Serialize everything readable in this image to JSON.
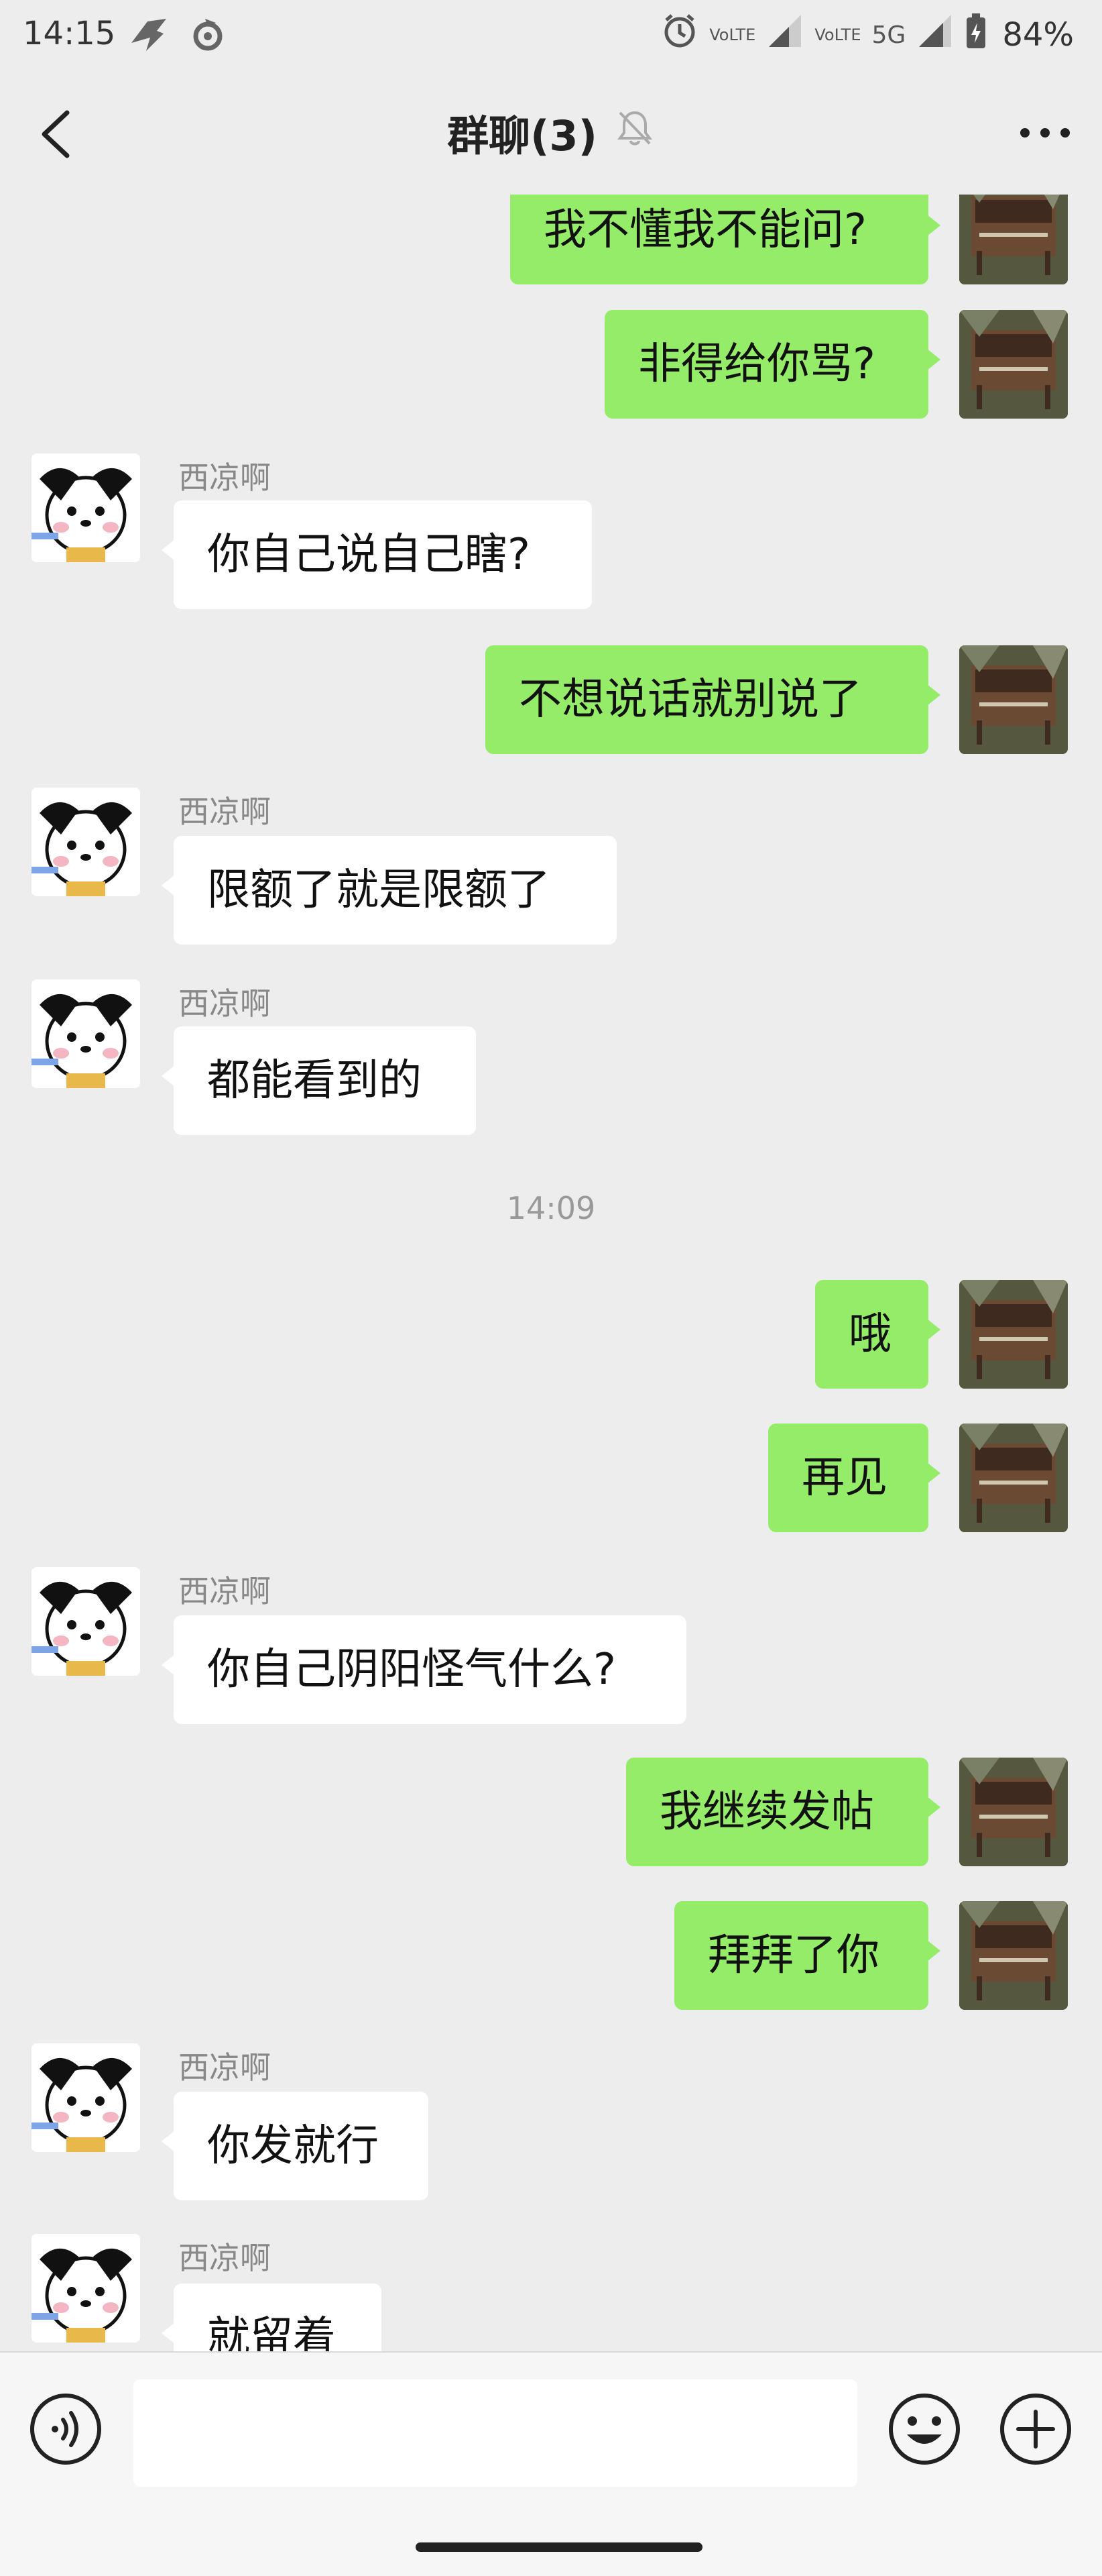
{
  "status_bar": {
    "time": "14:15",
    "network_1": "VoLTE",
    "network_2": "VoLTE",
    "network_type": "5G",
    "battery": "84%"
  },
  "header": {
    "title": "群聊(3)",
    "muted_icon": "bell-off-icon",
    "back_icon": "chevron-left-icon",
    "more_icon": "more-dots-icon"
  },
  "messages": [
    {
      "from": "self",
      "text": "我不懂我不能问?"
    },
    {
      "from": "self",
      "text": "非得给你骂?"
    },
    {
      "from": "other",
      "sender": "西凉啊",
      "text": "你自己说自己瞎?"
    },
    {
      "from": "self",
      "text": "不想说话就别说了"
    },
    {
      "from": "other",
      "sender": "西凉啊",
      "text": "限额了就是限额了"
    },
    {
      "from": "other",
      "sender": "西凉啊",
      "text": "都能看到的"
    },
    {
      "type": "timestamp",
      "text": "14:09"
    },
    {
      "from": "self",
      "text": "哦"
    },
    {
      "from": "self",
      "text": "再见"
    },
    {
      "from": "other",
      "sender": "西凉啊",
      "text": "你自己阴阳怪气什么?"
    },
    {
      "from": "self",
      "text": "我继续发帖"
    },
    {
      "from": "self",
      "text": "拜拜了你"
    },
    {
      "from": "other",
      "sender": "西凉啊",
      "text": "你发就行"
    },
    {
      "from": "other",
      "sender": "西凉啊",
      "text": "就留着"
    }
  ],
  "input_bar": {
    "text_value": "",
    "voice_icon": "voice-icon",
    "emoji_icon": "emoji-icon",
    "plus_icon": "plus-icon"
  },
  "colors": {
    "self_bubble": "#95ec69",
    "other_bubble": "#ffffff",
    "background": "#ededed"
  }
}
